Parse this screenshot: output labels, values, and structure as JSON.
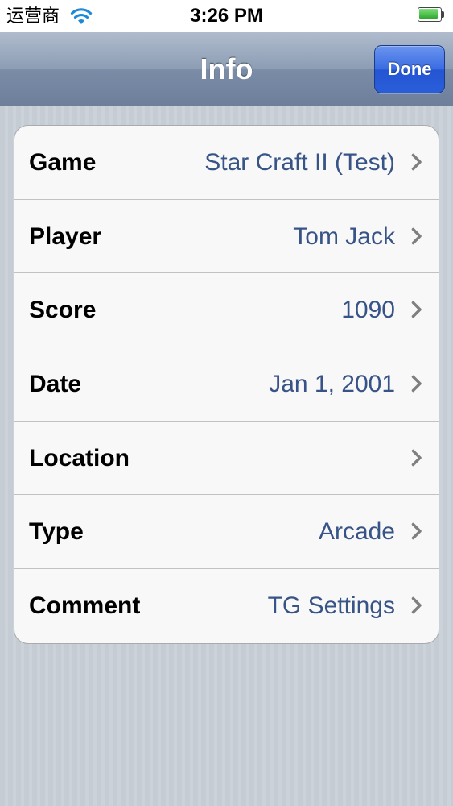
{
  "status_bar": {
    "carrier": "运营商",
    "time": "3:26 PM",
    "battery_level": 0.9
  },
  "nav_bar": {
    "title": "Info",
    "done_label": "Done"
  },
  "rows": [
    {
      "label": "Game",
      "value": "Star Craft II (Test)"
    },
    {
      "label": "Player",
      "value": "Tom Jack"
    },
    {
      "label": "Score",
      "value": "1090"
    },
    {
      "label": "Date",
      "value": "Jan 1, 2001"
    },
    {
      "label": "Location",
      "value": ""
    },
    {
      "label": "Type",
      "value": "Arcade"
    },
    {
      "label": "Comment",
      "value": "TG Settings"
    }
  ],
  "colors": {
    "value_text": "#385487",
    "done_button": "#2a5ed9",
    "nav_bar": "#8c9db4"
  },
  "icons": {
    "wifi": "wifi-icon",
    "battery": "battery-icon",
    "disclosure": "chevron-right-icon"
  }
}
